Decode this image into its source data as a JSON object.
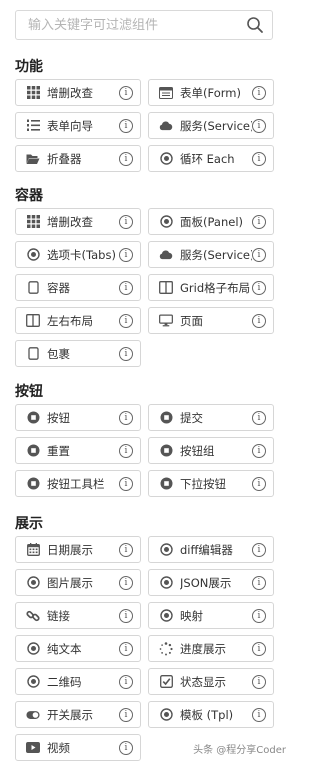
{
  "search": {
    "placeholder": "输入关键字可过滤组件"
  },
  "sections": [
    {
      "title": "功能",
      "items": [
        {
          "label": "增删改查",
          "icon": "grid-icon"
        },
        {
          "label": "表单(Form)",
          "icon": "form-icon"
        },
        {
          "label": "表单向导",
          "icon": "list-numbered-icon"
        },
        {
          "label": "服务(Service)",
          "icon": "cloud-icon"
        },
        {
          "label": "折叠器",
          "icon": "folder-open-icon"
        },
        {
          "label": "循环 Each",
          "icon": "dot-circle-icon"
        }
      ]
    },
    {
      "title": "容器",
      "items": [
        {
          "label": "增删改查",
          "icon": "grid-icon"
        },
        {
          "label": "面板(Panel)",
          "icon": "dot-circle-icon"
        },
        {
          "label": "选项卡(Tabs)",
          "icon": "dot-circle-icon"
        },
        {
          "label": "服务(Service)",
          "icon": "cloud-icon"
        },
        {
          "label": "容器",
          "icon": "square-icon"
        },
        {
          "label": "Grid格子布局",
          "icon": "columns-icon"
        },
        {
          "label": "左右布局",
          "icon": "columns-icon"
        },
        {
          "label": "页面",
          "icon": "desktop-icon"
        },
        {
          "label": "包裹",
          "icon": "square-icon"
        }
      ]
    },
    {
      "title": "按钮",
      "items": [
        {
          "label": "按钮",
          "icon": "stop-circle-icon"
        },
        {
          "label": "提交",
          "icon": "stop-circle-icon"
        },
        {
          "label": "重置",
          "icon": "stop-circle-icon"
        },
        {
          "label": "按钮组",
          "icon": "stop-circle-icon"
        },
        {
          "label": "按钮工具栏",
          "icon": "stop-circle-icon"
        },
        {
          "label": "下拉按钮",
          "icon": "stop-circle-icon"
        }
      ]
    },
    {
      "title": "展示",
      "items": [
        {
          "label": "日期展示",
          "icon": "calendar-icon"
        },
        {
          "label": "diff编辑器",
          "icon": "dot-circle-icon"
        },
        {
          "label": "图片展示",
          "icon": "dot-circle-icon"
        },
        {
          "label": "JSON展示",
          "icon": "dot-circle-icon"
        },
        {
          "label": "链接",
          "icon": "link-icon"
        },
        {
          "label": "映射",
          "icon": "dot-circle-icon"
        },
        {
          "label": "纯文本",
          "icon": "dot-circle-icon"
        },
        {
          "label": "进度展示",
          "icon": "spinner-icon"
        },
        {
          "label": "二维码",
          "icon": "dot-circle-icon"
        },
        {
          "label": "状态显示",
          "icon": "check-square-icon"
        },
        {
          "label": "开关展示",
          "icon": "toggle-on-icon"
        },
        {
          "label": "模板 (Tpl)",
          "icon": "dot-circle-icon"
        },
        {
          "label": "视频",
          "icon": "video-icon"
        }
      ]
    }
  ],
  "info_glyph": "i",
  "watermark": "头条 @程分享Coder"
}
